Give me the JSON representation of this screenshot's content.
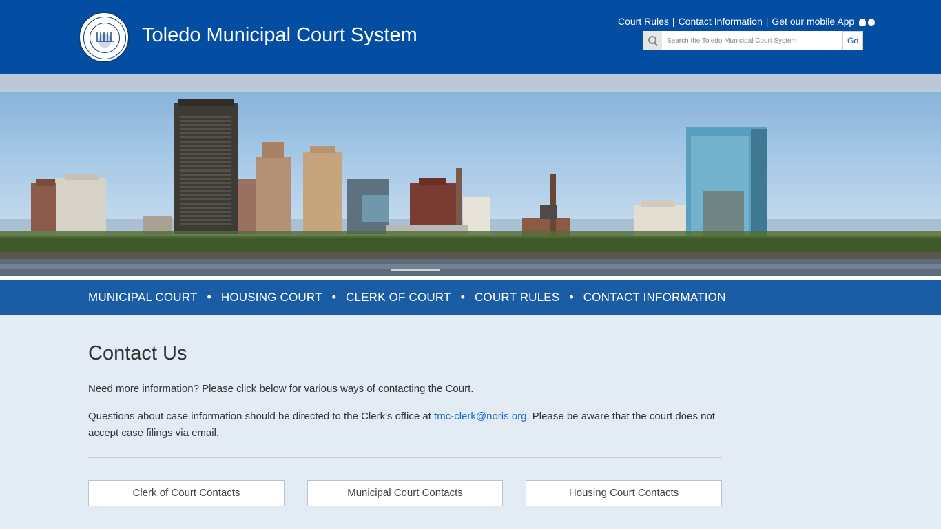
{
  "header": {
    "title": "Toledo Municipal Court System",
    "seal_alt": "Seal of the City of Toledo",
    "top_links": [
      {
        "label": "Court Rules"
      },
      {
        "label": "Contact Information"
      },
      {
        "label": "Get our mobile App"
      }
    ],
    "separator": "|",
    "app_icons": [
      "android-icon",
      "apple-icon"
    ],
    "search": {
      "placeholder": "Search the Toledo Municipal Court System",
      "value": "",
      "button_label": "Go"
    }
  },
  "nav": {
    "items": [
      {
        "label": "MUNICIPAL COURT"
      },
      {
        "label": "HOUSING COURT"
      },
      {
        "label": "CLERK OF COURT"
      },
      {
        "label": "COURT RULES"
      },
      {
        "label": "CONTACT INFORMATION"
      }
    ],
    "separator": "•"
  },
  "main": {
    "title": "Contact Us",
    "intro": "Need more information? Please click below for various ways of contacting the Court.",
    "case_info_prefix": "Questions about case information should be directed to the Clerk's office at ",
    "email": "tmc-clerk@noris.org",
    "case_info_suffix": ". Please be aware that the court does not accept case filings via email.",
    "buttons": [
      {
        "label": "Clerk of Court Contacts"
      },
      {
        "label": "Municipal Court Contacts"
      },
      {
        "label": "Housing Court Contacts"
      }
    ]
  },
  "colors": {
    "header_bg": "#034ea2",
    "nav_bg": "#1b5da4",
    "page_bg": "#e3ebf4",
    "link": "#1b6ac9"
  }
}
